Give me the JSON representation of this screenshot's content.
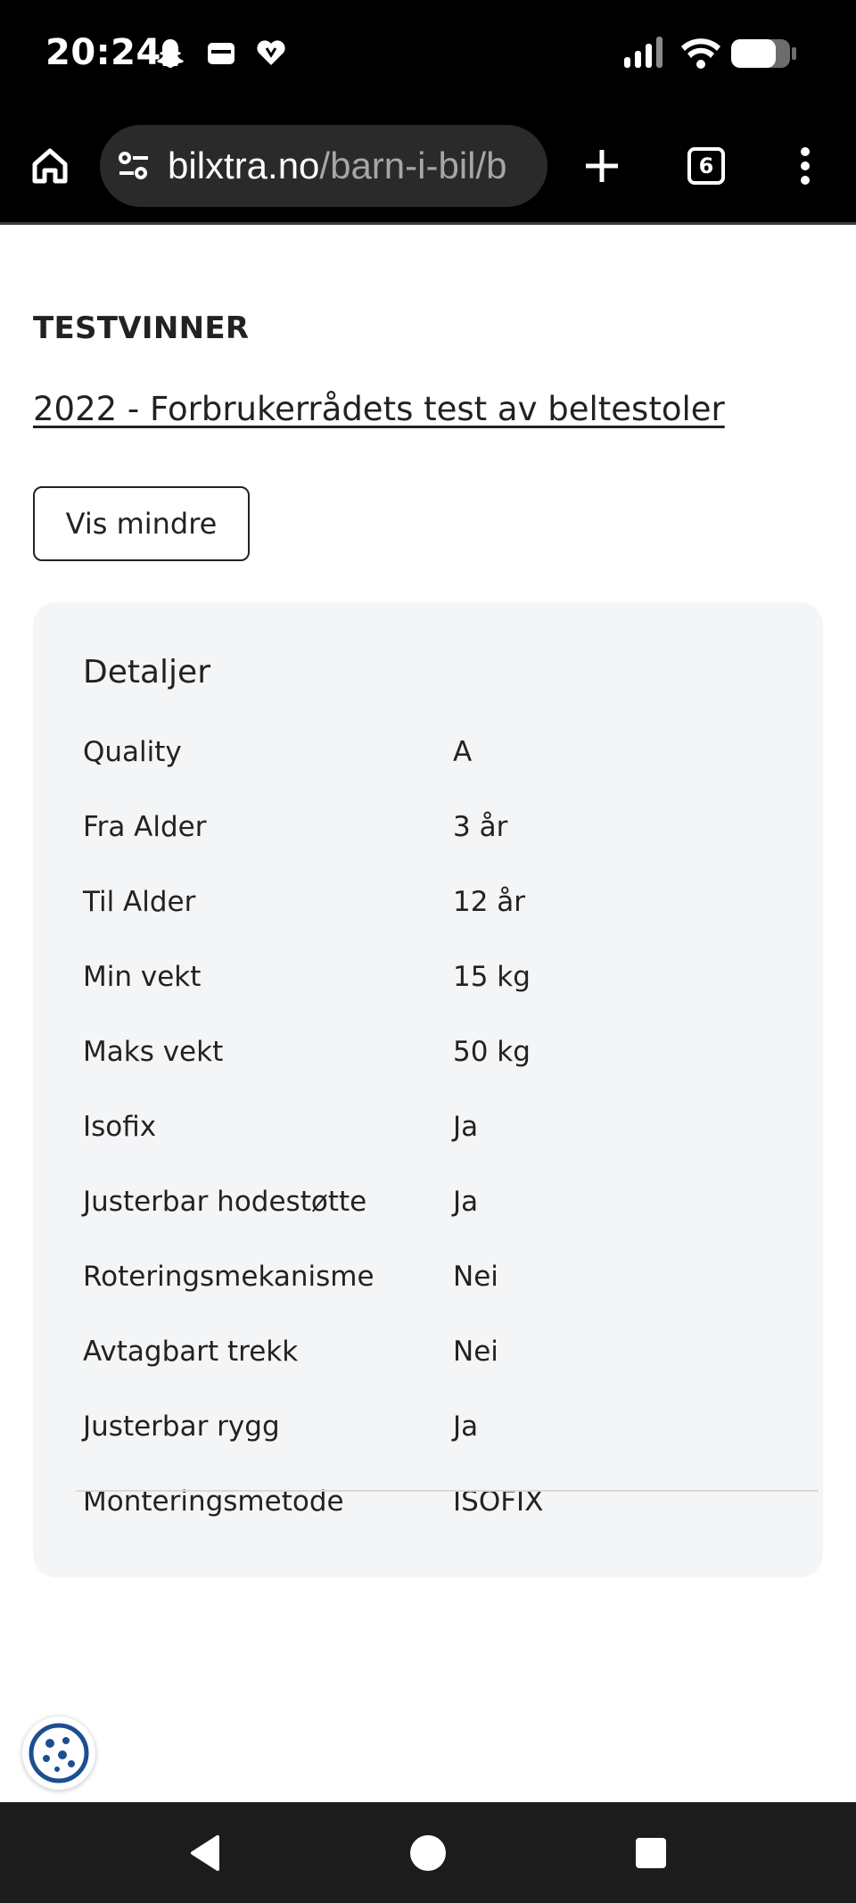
{
  "status_bar": {
    "time": "20:24",
    "icons": [
      "snapchat-icon",
      "wallet-icon",
      "heart-app-icon",
      "signal-icon",
      "wifi-icon",
      "battery-icon"
    ]
  },
  "browser": {
    "url_domain": "bilxtra.no",
    "url_path": "/barn-i-bil/b",
    "tab_count": "6"
  },
  "page": {
    "heading": "TESTVINNER",
    "link": "2022 - Forbrukerrådets test av beltestoler",
    "toggle_label": "Vis mindre",
    "details": {
      "title": "Detaljer",
      "rows": [
        {
          "label": "Quality",
          "value": "A"
        },
        {
          "label": "Fra Alder",
          "value": "3 år"
        },
        {
          "label": "Til Alder",
          "value": "12 år"
        },
        {
          "label": "Min vekt",
          "value": "15 kg"
        },
        {
          "label": "Maks vekt",
          "value": "50 kg"
        },
        {
          "label": "Isofix",
          "value": "Ja"
        },
        {
          "label": "Justerbar hodestøtte",
          "value": "Ja"
        },
        {
          "label": "Roteringsmekanisme",
          "value": "Nei"
        },
        {
          "label": "Avtagbart trekk",
          "value": "Nei"
        },
        {
          "label": "Justerbar rygg",
          "value": "Ja"
        },
        {
          "label": "Monteringsmetode",
          "value": "ISOFIX"
        }
      ]
    }
  },
  "colors": {
    "bar_bg": "#000000",
    "url_pill": "#2a2a2a",
    "card_bg": "#f4f5f7",
    "cookie_accent": "#1d4f8f"
  }
}
